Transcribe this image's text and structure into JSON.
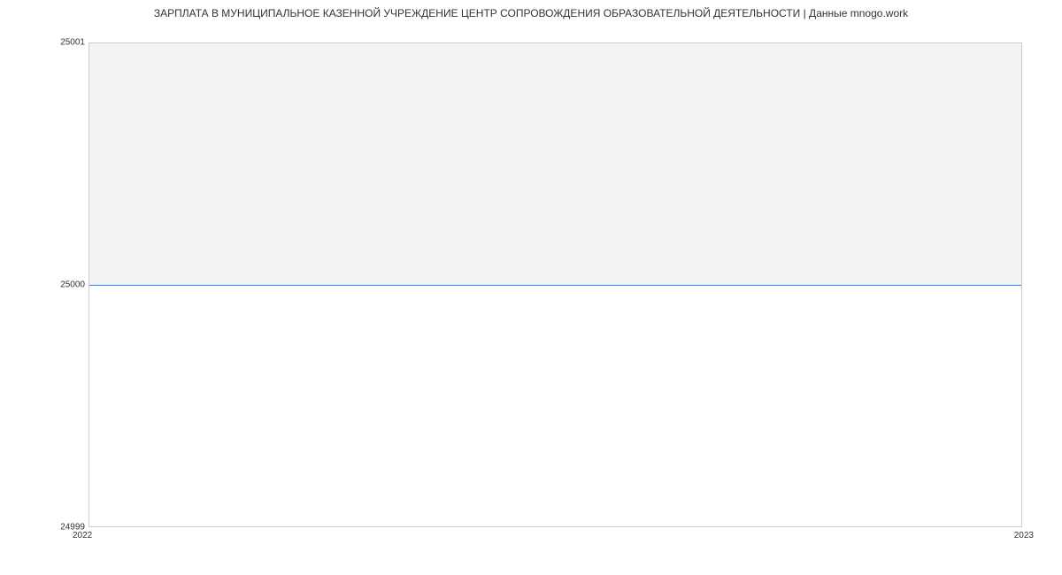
{
  "chart_data": {
    "type": "line",
    "title": "ЗАРПЛАТА В МУНИЦИПАЛЬНОЕ КАЗЕННОЙ УЧРЕЖДЕНИЕ ЦЕНТР СОПРОВОЖДЕНИЯ ОБРАЗОВАТЕЛЬНОЙ ДЕЯТЕЛЬНОСТИ | Данные mnogo.work",
    "x": [
      2022,
      2023
    ],
    "values": [
      25000,
      25000
    ],
    "xlabel": "",
    "ylabel": "",
    "xlim": [
      2022,
      2023
    ],
    "ylim": [
      24999,
      25001
    ],
    "x_ticks": [
      "2022",
      "2023"
    ],
    "y_ticks": [
      "25001",
      "25000",
      "24999"
    ],
    "line_color": "#4a7fd6",
    "band_colors": [
      "#f3f3f3",
      "#ffffff"
    ]
  }
}
